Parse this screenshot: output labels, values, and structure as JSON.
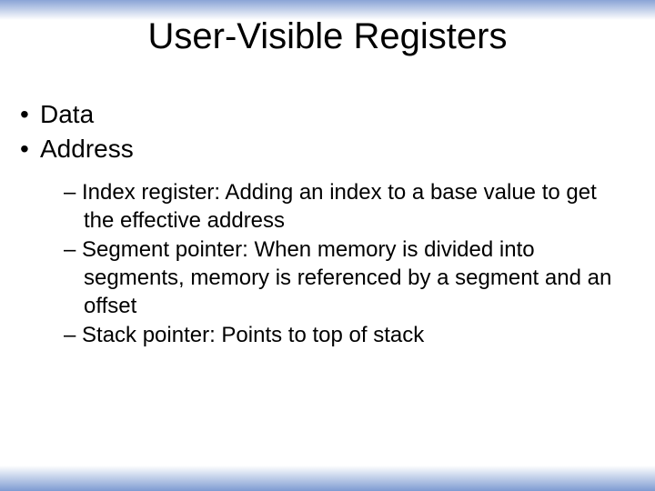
{
  "title": "User-Visible Registers",
  "bullets": {
    "data": "Data",
    "address": "Address"
  },
  "sub": {
    "index": "– Index register: Adding an index to a base value to get the effective address",
    "segment": "– Segment pointer: When memory is divided into segments, memory is referenced by a segment and an offset",
    "stack": "– Stack pointer: Points to top of stack"
  }
}
